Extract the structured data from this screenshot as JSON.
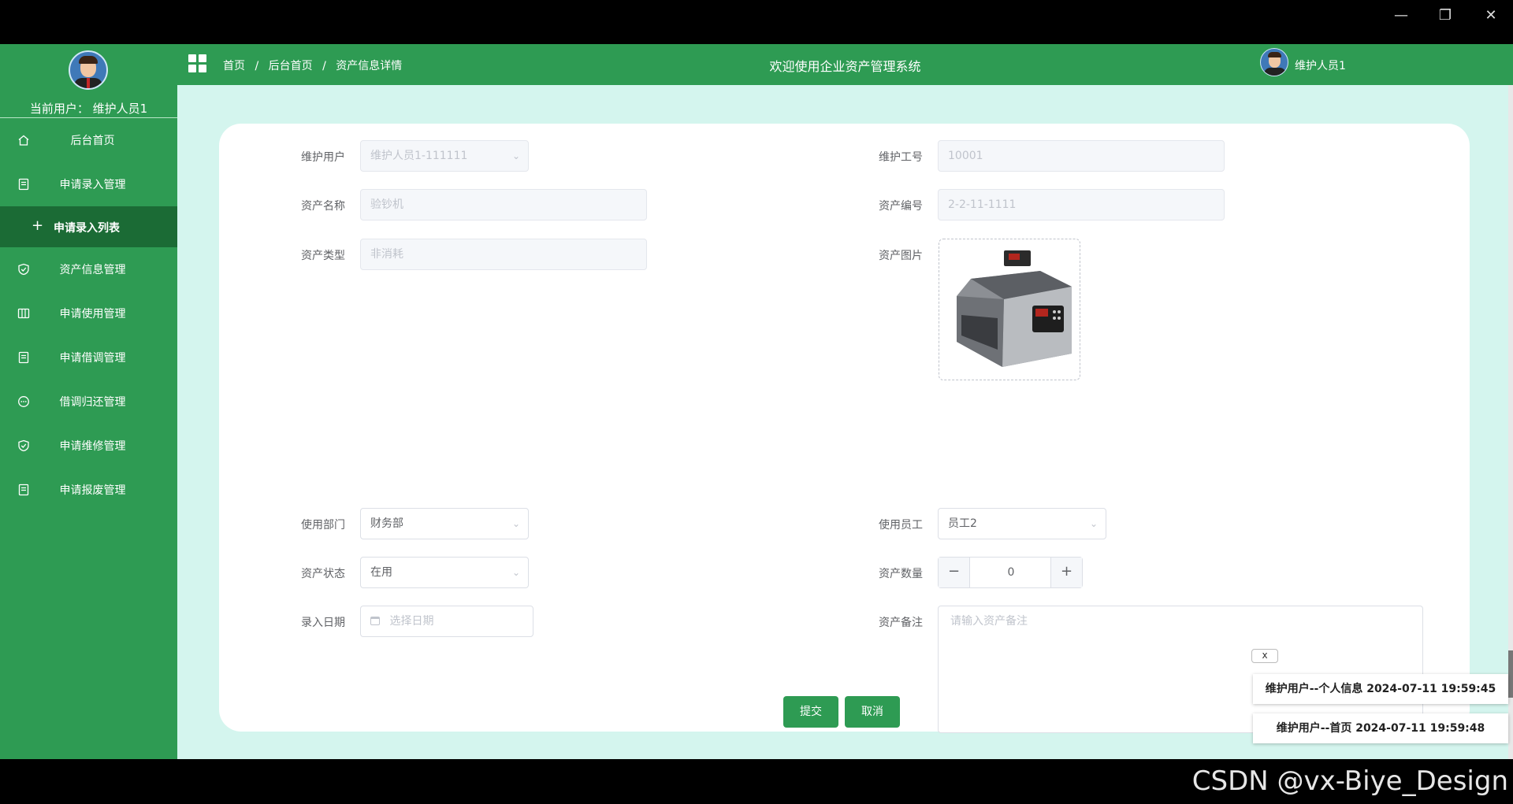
{
  "window": {
    "minimize": "—",
    "restore": "❐",
    "close": "✕"
  },
  "sidebar": {
    "current_user": "当前用户：  维护人员1",
    "items": [
      {
        "label": "后台首页",
        "icon": "home-icon"
      },
      {
        "label": "申请录入管理",
        "icon": "document-icon"
      },
      {
        "label": "资产信息管理",
        "icon": "shield-check-icon"
      },
      {
        "label": "申请使用管理",
        "icon": "columns-icon"
      },
      {
        "label": "申请借调管理",
        "icon": "document-icon"
      },
      {
        "label": "借调归还管理",
        "icon": "chat-icon"
      },
      {
        "label": "申请维修管理",
        "icon": "shield-check-icon"
      },
      {
        "label": "申请报废管理",
        "icon": "document-icon"
      }
    ],
    "active_sub": {
      "icon": "+",
      "label": "申请录入列表"
    }
  },
  "topbar": {
    "breadcrumb": [
      "首页",
      "后台首页",
      "资产信息详情"
    ],
    "separator": "/",
    "title": "欢迎使用企业资产管理系统",
    "user_name": "维护人员1"
  },
  "form": {
    "maint_user": {
      "label": "维护用户",
      "value": "维护人员1-111111"
    },
    "maint_no": {
      "label": "维护工号",
      "value": "10001"
    },
    "asset_name": {
      "label": "资产名称",
      "value": "验钞机"
    },
    "asset_no": {
      "label": "资产编号",
      "value": "2-2-11-1111"
    },
    "asset_type": {
      "label": "资产类型",
      "value": "非消耗"
    },
    "asset_image": {
      "label": "资产图片"
    },
    "dept": {
      "label": "使用部门",
      "value": "财务部"
    },
    "employee": {
      "label": "使用员工",
      "value": "员工2"
    },
    "status": {
      "label": "资产状态",
      "value": "在用"
    },
    "quantity": {
      "label": "资产数量",
      "value": "0",
      "minus": "−",
      "plus": "+"
    },
    "entry_date": {
      "label": "录入日期",
      "placeholder": "选择日期"
    },
    "remark": {
      "label": "资产备注",
      "placeholder": "请输入资产备注"
    },
    "submit": "提交",
    "cancel": "取消"
  },
  "notices": {
    "close": "x",
    "items": [
      "维护用户--个人信息 2024-07-11 19:59:45",
      "维护用户--首页 2024-07-11 19:59:48"
    ]
  },
  "watermark": "CSDN @vx-Biye_Design",
  "colors": {
    "primary": "#2e9b53",
    "dark": "#1b6b35",
    "background": "#d4f5ee"
  }
}
